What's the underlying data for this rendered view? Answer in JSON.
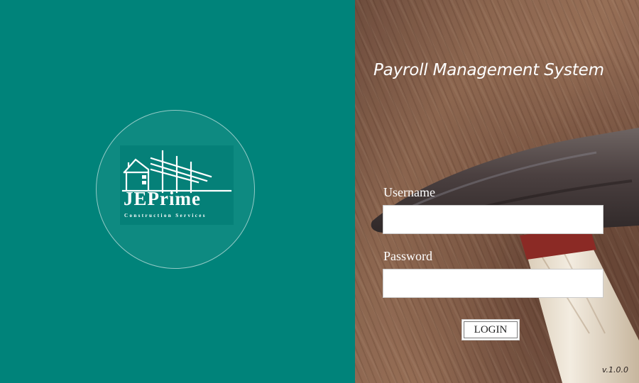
{
  "brand": {
    "name": "JEPrime",
    "tagline": "Construction Services",
    "logo_icon": "house-scaffold-icon",
    "background_color": "#00837A"
  },
  "login": {
    "title": "Payroll Management System",
    "username_label": "Username",
    "username_value": "",
    "password_label": "Password",
    "password_value": "",
    "login_button": "LOGIN",
    "version": "v.1.0.0",
    "background_image": "wood-hammer-photo"
  }
}
